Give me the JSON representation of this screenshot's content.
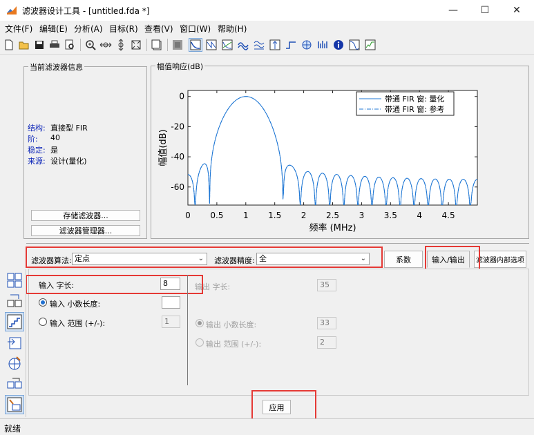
{
  "window": {
    "title": "滤波器设计工具 -  [untitled.fda *]",
    "minimize_glyph": "—",
    "maximize_glyph": "☐",
    "close_glyph": "✕"
  },
  "menu": [
    "文件(F)",
    "编辑(E)",
    "分析(A)",
    "目标(R)",
    "查看(V)",
    "窗口(W)",
    "帮助(H)"
  ],
  "toolbar_icons": [
    "new-icon",
    "open-icon",
    "save-icon",
    "print-icon",
    "print-preview-icon",
    "zoom-in-icon",
    "zoom-x-icon",
    "zoom-y-icon",
    "full-view-icon",
    "new-figure-icon",
    "design-filter-icon",
    "magnitude-icon",
    "phase-icon",
    "magnitude-phase-icon",
    "group-delay-icon",
    "phase-delay-icon",
    "impulse-icon",
    "step-icon",
    "pole-zero-icon",
    "coefficients-icon",
    "info-icon",
    "magnitude-estimate-icon",
    "noise-icon"
  ],
  "current_filter": {
    "title": "当前滤波器信息",
    "rows": [
      {
        "label": "结构:",
        "value": "直接型 FIR"
      },
      {
        "label": "阶:",
        "value": "40"
      },
      {
        "label": "稳定:",
        "value": "是"
      },
      {
        "label": "来源:",
        "value": "设计(量化)"
      }
    ],
    "store_button": "存储滤波器...",
    "manager_button": "滤波器管理器..."
  },
  "plot_panel": {
    "title": "幅值响应(dB)"
  },
  "chart_data": {
    "type": "line",
    "xlabel": "频率 (MHz)",
    "ylabel": "幅值(dB)",
    "xlim": [
      0,
      5
    ],
    "ylim": [
      -72,
      4
    ],
    "xticks": [
      "0",
      "0.5",
      "1",
      "1.5",
      "2",
      "2.5",
      "3",
      "3.5",
      "4",
      "4.5"
    ],
    "yticks": [
      "0",
      "-20",
      "-40",
      "-60"
    ],
    "xtick_values": [
      0,
      0.5,
      1,
      1.5,
      2,
      2.5,
      3,
      3.5,
      4,
      4.5
    ],
    "ytick_values": [
      0,
      -20,
      -40,
      -60
    ],
    "legend_position": "top-right",
    "series": [
      {
        "name": "带通 FIR 窗: 量化",
        "style": "solid",
        "color": "#1f77d4"
      },
      {
        "name": "带通 FIR 窗: 参考",
        "style": "dashdot",
        "color": "#1f77d4"
      }
    ],
    "sidelobe_peak_db": -41,
    "passband_peak_mhz": 1.0
  },
  "quantization": {
    "arithmetic_label": "滤波器算法:",
    "arithmetic_value": "定点",
    "precision_label": "滤波器精度:",
    "precision_value": "全",
    "tabs": [
      "系数",
      "输入/输出",
      "滤波器内部选项"
    ]
  },
  "io": {
    "input_word_label": "输入 字长:",
    "input_word_value": "8",
    "input_frac_label": "输入 小数长度:",
    "input_frac_value": "",
    "input_range_label": "输入 范围 (+/-):",
    "input_range_value": "1",
    "output_word_label": "输出 字长:",
    "output_word_value": "35",
    "output_frac_label": "输出 小数长度:",
    "output_frac_value": "33",
    "output_range_label": "输出 范围 (+/-):",
    "output_range_value": "2",
    "apply_button": "应用"
  },
  "left_icons": [
    "design-filter-panel-icon",
    "transform-icon",
    "quantize-icon",
    "import-icon",
    "pole-zero-editor-icon",
    "multirate-icon",
    "realize-model-icon"
  ],
  "status": "就绪"
}
